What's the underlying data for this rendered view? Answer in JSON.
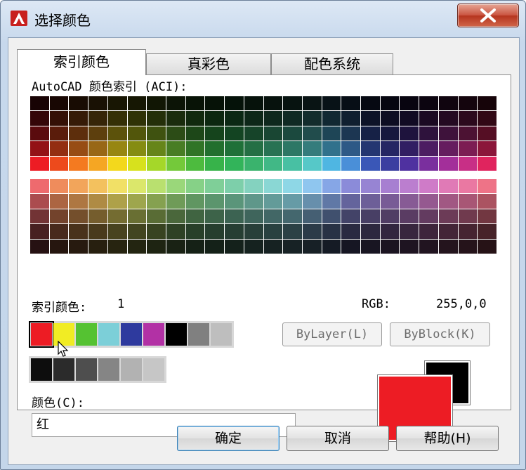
{
  "window": {
    "title": "选择颜色",
    "close_label": "X"
  },
  "tabs": [
    {
      "label": "索引颜色",
      "active": true
    },
    {
      "label": "真彩色",
      "active": false
    },
    {
      "label": "配色系统",
      "active": false
    }
  ],
  "aci": {
    "label": "AutoCAD 颜色索引 (ACI):",
    "upper_hues": [
      "#ed1c24",
      "#ed4a1c",
      "#f47a20",
      "#f5a623",
      "#f3d81c",
      "#d7e11d",
      "#a5d729",
      "#74c93a",
      "#4dbb3e",
      "#37b34a",
      "#32b45a",
      "#3ab36d",
      "#41b886",
      "#48c0a3",
      "#56c8c8",
      "#4fb6e2",
      "#4a8fd8",
      "#3a57b7",
      "#3b3ea0",
      "#4f31a0",
      "#7a2f9e",
      "#a32f9a",
      "#c82f86",
      "#e0245e"
    ],
    "lower_hues": [
      "#ee6a6e",
      "#ef8c5c",
      "#f2a55b",
      "#f3c15e",
      "#f1e066",
      "#dbe76b",
      "#b9e06f",
      "#9ad77a",
      "#86d187",
      "#7fcf98",
      "#7dcfaa",
      "#84d2bf",
      "#8ad7d4",
      "#8ed7e6",
      "#8fc6ef",
      "#86a6e6",
      "#8b8bd9",
      "#9784d3",
      "#a77fd1",
      "#bb7ecf",
      "#cf7bc8",
      "#e07ab6",
      "#ea78a2",
      "#ee7387"
    ]
  },
  "info": {
    "index_label": "索引颜色:",
    "index_value": "1",
    "rgb_label": "RGB:",
    "rgb_value": "255,0,0"
  },
  "std_colors": [
    "#ed1c24",
    "#f1ec24",
    "#55c232",
    "#7ccfd8",
    "#2e3a9e",
    "#b231a5",
    "#000000",
    "#808080",
    "#bebebe"
  ],
  "gray_colors": [
    "#0d0d0d",
    "#2b2b2b",
    "#4e4e4e",
    "#858585",
    "#b2b2b2",
    "#c6c6c6"
  ],
  "buttons": {
    "bylayer": "ByLayer(L)",
    "byblock": "ByBlock(K)",
    "ok": "确定",
    "cancel": "取消",
    "help": "帮助(H)"
  },
  "color_field": {
    "label": "颜色(C):",
    "value": "红"
  },
  "preview": {
    "new_color": "#ed1c24",
    "old_color": "#000000"
  }
}
